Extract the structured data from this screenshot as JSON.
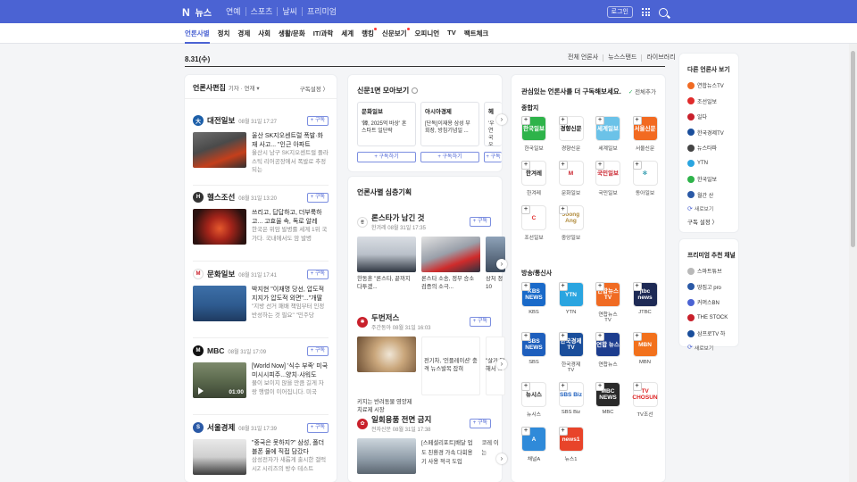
{
  "header": {
    "logo": "N",
    "title": "뉴스",
    "links": [
      "연예",
      "스포츠",
      "날씨",
      "프리미엄"
    ],
    "login": "로그인"
  },
  "categories": [
    "언론사별",
    "정치",
    "경제",
    "사회",
    "생활/문화",
    "IT/과학",
    "세계",
    "랭킹",
    "신문보기",
    "오피니언",
    "TV",
    "팩트체크"
  ],
  "datebar": {
    "date": "8.31(수)",
    "links": [
      "전체 언론사",
      "뉴스스탠드",
      "라이브러리"
    ]
  },
  "left": {
    "title": "언론사편집",
    "filter": "기자 · 연재 ▾",
    "setting": "구독설정 〉",
    "subscribe_label": "+ 구독",
    "press": [
      {
        "name": "대전일보",
        "time": "08월 31일 17:27",
        "title": "울산 SK지오센트럴 폭발·화재 사고... \"인근 아파트",
        "desc": "울산시 남구 SK지오센트럴 플라스틱 리어공장에서 폭발로 추정되는",
        "logo_color": "#1b5ea8",
        "logo_text": "大"
      },
      {
        "name": "헬스조선",
        "time": "08월 31일 13:20",
        "title": "쓰리고, 답답하고, 더부룩하고... 고효율 속, 독로 알레",
        "desc": "한국은 위암 발병률 세계 1위 국가다. 국내에서도 암 발병",
        "logo_color": "#333333",
        "logo_text": "H"
      },
      {
        "name": "문화일보",
        "time": "08월 31일 17:41",
        "title": "박지현 \"이재명 당선, 압도적 지지가 압도적 외면\"...\"개딸",
        "desc": "\"지방 선거 패배 책임부터 인정 반성하는 것 필요\" \"민주당",
        "logo_color": "#c9202b",
        "logo_text": "M"
      },
      {
        "name": "MBC",
        "time": "08월 31일 17:09",
        "title": "[World Now] '식수 부족' 미국 미시시피주...양치·샤워도",
        "desc": "물이 보이지 않을 만큼 길게 자랑 행렬이 이어집니다. 미국",
        "logo_color": "#111111",
        "logo_text": "M",
        "video_time": "01:00"
      },
      {
        "name": "서울경제",
        "time": "08월 31일 17:39",
        "title": "\"중국은 못하지?\" 삼성, 폴더블폰 물에 직접 담갔다",
        "desc": "삼성전자가 새롭게 출시한 갤럭시Z 시리즈의 방수 테스트",
        "logo_color": "#2a59a6",
        "logo_text": "S"
      }
    ]
  },
  "mid": {
    "frontpage_title": "신문1면 모아보기",
    "cards": [
      {
        "name": "문화일보",
        "text": "'韓, 2025억 바상' 혼 스타트 일단락"
      },
      {
        "name": "아시아경제",
        "text": "[단독]이재용 삼성 부회장, 방침기념일 ..."
      },
      {
        "name": "헤",
        "text": "'우연국 우어레'"
      }
    ],
    "card_btn": "+ 구독하기",
    "deep_title": "언론사별 심층기획",
    "deep": [
      {
        "title": "론스타가 남긴 것",
        "press": "한겨레",
        "time": "08월 31일 17:35",
        "caps": [
          "한동훈 \"론스타, 끝까지 다투겠...",
          "론스타 소송, 정부 승소 검증의 소극...",
          "상처 정 10"
        ]
      },
      {
        "title": "두번저스",
        "press": "주간동아",
        "time": "08월 31일 16:03",
        "caps": [
          "키지는 반려동물 영양제 치료제 시장",
          "전기차, '인플레이션' 충격 뉴스발목 잡혀",
          "\"살기 답해서 ..."
        ]
      },
      {
        "title": "일회용품 전면 금지",
        "press": "전자신문",
        "time": "08월 31일 17:38",
        "caps": [
          "[스페셜리포트]배달 업도 친환경 가속...",
          "[스페셜리포트]배달 업도 친환경 가속 다회용기 사용 적극 도입",
          "코레 이는"
        ]
      }
    ]
  },
  "right": {
    "title": "관심있는 언론사를 더 구독해보세요.",
    "all_subscribe": "전체추가",
    "section1": "종합지",
    "section2": "방송/통신사",
    "general": [
      {
        "label": "한국일보",
        "logo": "한국일보",
        "bg": "#2eb34a",
        "fg": "#ffffff"
      },
      {
        "label": "경향신문",
        "logo": "경향신문",
        "bg": "#ffffff",
        "fg": "#111111"
      },
      {
        "label": "세계일보",
        "logo": "세계일보",
        "bg": "#6bc2e8",
        "fg": "#ffffff"
      },
      {
        "label": "서울신문",
        "logo": "서울신문",
        "bg": "#f26a21",
        "fg": "#ffffff"
      },
      {
        "label": "한겨레",
        "logo": "한겨레",
        "bg": "#ffffff",
        "fg": "#222222"
      },
      {
        "label": "문화일보",
        "logo": "M",
        "bg": "#ffffff",
        "fg": "#c9202b"
      },
      {
        "label": "국민일보",
        "logo": "국민일보",
        "bg": "#ffffff",
        "fg": "#c9202b"
      },
      {
        "label": "동아일보",
        "logo": "✻",
        "bg": "#ffffff",
        "fg": "#0e8aa0"
      },
      {
        "label": "조선일보",
        "logo": "C",
        "bg": "#ffffff",
        "fg": "#e02b2b"
      },
      {
        "label": "중앙일보",
        "logo": "Joong Ang",
        "bg": "#ffffff",
        "fg": "#b08a3a"
      }
    ],
    "broadcast": [
      {
        "label": "KBS",
        "logo": "KBS NEWS",
        "bg": "#1a6ac9",
        "fg": "#ffffff"
      },
      {
        "label": "YTN",
        "logo": "YTN",
        "bg": "#2aa5e0",
        "fg": "#ffffff"
      },
      {
        "label": "연합뉴스TV",
        "logo": "연합뉴스TV",
        "bg": "#f06b23",
        "fg": "#ffffff"
      },
      {
        "label": "JTBC",
        "logo": "jtbc news",
        "bg": "#1e2a55",
        "fg": "#ffffff"
      },
      {
        "label": "SBS",
        "logo": "SBS NEWS",
        "bg": "#1e5fbd",
        "fg": "#ffffff"
      },
      {
        "label": "한국경제TV",
        "logo": "한국경제TV",
        "bg": "#1a4e9b",
        "fg": "#ffffff"
      },
      {
        "label": "연합뉴스",
        "logo": "연합 뉴스",
        "bg": "#1d3d8e",
        "fg": "#ffffff"
      },
      {
        "label": "MBN",
        "logo": "MBN",
        "bg": "#f2711c",
        "fg": "#ffffff"
      },
      {
        "label": "뉴시스",
        "logo": "뉴시스",
        "bg": "#ffffff",
        "fg": "#111111"
      },
      {
        "label": "SBS Biz",
        "logo": "SBS Biz",
        "bg": "#ffffff",
        "fg": "#1e5fbd"
      },
      {
        "label": "MBC",
        "logo": "MBC NEWS",
        "bg": "#2a2a2a",
        "fg": "#ffffff"
      },
      {
        "label": "TV조선",
        "logo": "TV CHOSUN",
        "bg": "#ffffff",
        "fg": "#d22"
      },
      {
        "label": "채널A",
        "logo": "A",
        "bg": "#2f8ad9",
        "fg": "#ffffff"
      },
      {
        "label": "뉴스1",
        "logo": "news1",
        "bg": "#e8442a",
        "fg": "#ffffff"
      }
    ]
  },
  "far": {
    "title": "다른 언론사 보기",
    "others": [
      {
        "name": "연합뉴스TV",
        "color": "#f06b23"
      },
      {
        "name": "조선일보",
        "color": "#e02b2b"
      },
      {
        "name": "일다",
        "color": "#c9202b"
      },
      {
        "name": "한국경제TV",
        "color": "#1a4e9b"
      },
      {
        "name": "뉴스타파",
        "color": "#444444"
      },
      {
        "name": "YTN",
        "color": "#2aa5e0"
      },
      {
        "name": "한국일보",
        "color": "#2eb34a"
      },
      {
        "name": "월간 산",
        "color": "#2a59a6"
      }
    ],
    "more": "새로보기",
    "setting": "구독 설정 〉",
    "premium_title": "프리미엄 추천 채널",
    "premium": [
      {
        "name": "스마트튜브",
        "color": "#b9b9b9"
      },
      {
        "name": "땅집고 pro",
        "color": "#2a59a6"
      },
      {
        "name": "커머스BN",
        "color": "#4b63d3"
      },
      {
        "name": "THE STOCK",
        "color": "#c9202b"
      },
      {
        "name": "삼프로TV 하",
        "color": "#1a4e9b"
      }
    ],
    "premium_more": "새로보기"
  }
}
